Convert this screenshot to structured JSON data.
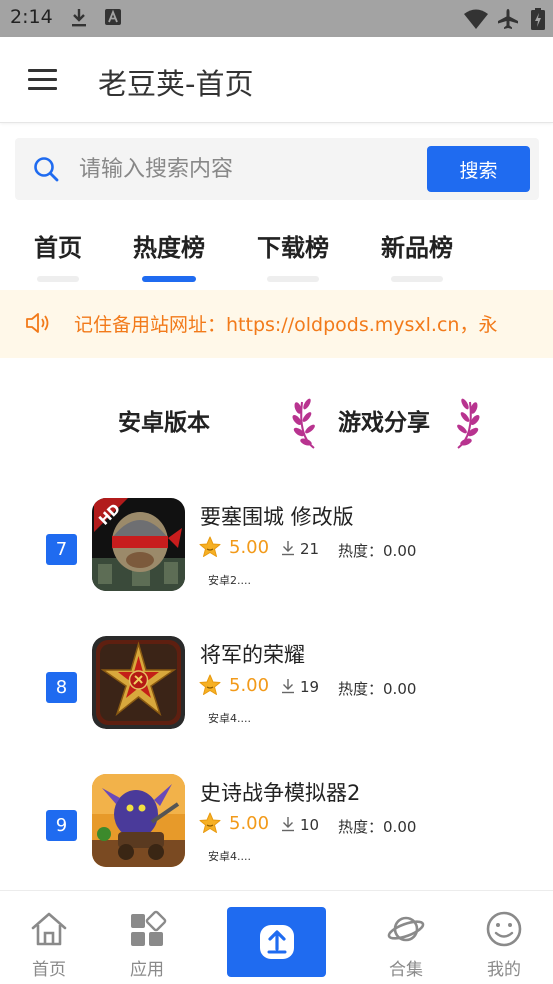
{
  "status_bar": {
    "time": "2:14"
  },
  "app_bar": {
    "title": "老豆荚-首页"
  },
  "search": {
    "placeholder": "请输入搜索内容",
    "button_label": "搜索"
  },
  "tabs": [
    {
      "label": "首页",
      "active": false
    },
    {
      "label": "热度榜",
      "active": true
    },
    {
      "label": "下载榜",
      "active": false
    },
    {
      "label": "新品榜",
      "active": false
    }
  ],
  "notice": {
    "text": "记住备用站网址：https://oldpods.mysxl.cn，永"
  },
  "ribbons": {
    "left": "安卓版本",
    "right": "游戏分享"
  },
  "list": [
    {
      "rank": "7",
      "name": "要塞围城 修改版",
      "rating": "5.00",
      "downloads": "21",
      "heat_label": "热度：",
      "heat": "0.00",
      "version": "安卓2....",
      "icon": "fortress-game-icon"
    },
    {
      "rank": "8",
      "name": "将军的荣耀",
      "rating": "5.00",
      "downloads": "19",
      "heat_label": "热度：",
      "heat": "0.00",
      "version": "安卓4....",
      "icon": "general-glory-game-icon"
    },
    {
      "rank": "9",
      "name": "史诗战争模拟器2",
      "rating": "5.00",
      "downloads": "10",
      "heat_label": "热度：",
      "heat": "0.00",
      "version": "安卓4....",
      "icon": "epic-battle-game-icon"
    }
  ],
  "bottom_nav": [
    {
      "label": "首页",
      "icon": "home-icon"
    },
    {
      "label": "应用",
      "icon": "apps-icon"
    },
    {
      "label": "",
      "icon": "upload-icon"
    },
    {
      "label": "合集",
      "icon": "planet-icon"
    },
    {
      "label": "我的",
      "icon": "smiley-icon"
    }
  ],
  "colors": {
    "primary": "#1f6bf0",
    "notice_text": "#f27a1a",
    "notice_bg": "#fff8e9",
    "rating": "#f29a1a",
    "laurel": "#b8338f"
  }
}
